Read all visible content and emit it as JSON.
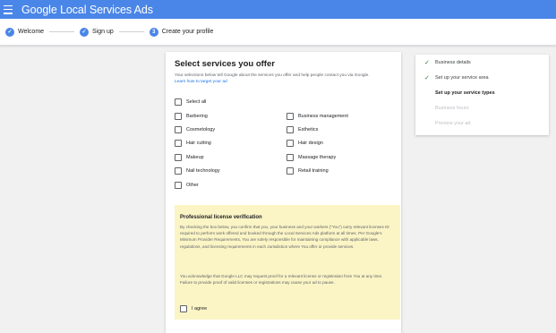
{
  "header": {
    "title": "Google Local Services Ads"
  },
  "stepper": {
    "steps": [
      {
        "label": "Welcome",
        "marker": "✓"
      },
      {
        "label": "Sign up",
        "marker": "✓"
      },
      {
        "label": "Create your profile",
        "marker": "3"
      }
    ]
  },
  "services": {
    "title": "Select services you offer",
    "description": "Your selections below tell Google about the services you offer and help people contact you via Google.",
    "learn_link": "Learn how to target your ad",
    "select_all": "Select all",
    "left_column": [
      "Barbering",
      "Cosmetology",
      "Hair cutting",
      "Makeup",
      "Nail technology",
      "Other"
    ],
    "right_column": [
      "Business management",
      "Esthetics",
      "Hair design",
      "Massage therapy",
      "Retail training"
    ]
  },
  "license": {
    "title": "Professional license verification",
    "paragraph1": "By checking the box below, you confirm that you, your business and your workers (\"You\") carry relevant licenses ID required to perform work offered and booked through the Local Services Ads platform at all times. Per Google's Minimum Provider Requirements, You are solely responsible for maintaining compliance with applicable laws, regulations, and licensing requirements in each Jurisdiction where You offer or provide services.",
    "paragraph2": "You acknowledge that Google LLC may request proof for a relevant license or registration from You at any time. Failure to provide proof of valid licenses or registrations may cause your ad to pause.",
    "agree_label": "I agree"
  },
  "progress": {
    "items": [
      {
        "label": "Business details",
        "state": "done"
      },
      {
        "label": "Set up your service area",
        "state": "done"
      },
      {
        "label": "Set up your service types",
        "state": "current"
      },
      {
        "label": "Business hours",
        "state": "pending"
      },
      {
        "label": "Preview your ad",
        "state": "pending"
      }
    ]
  },
  "colors": {
    "header_blue": "#4a86e8",
    "check_green": "#188038",
    "license_bg": "#fbf5c6"
  }
}
